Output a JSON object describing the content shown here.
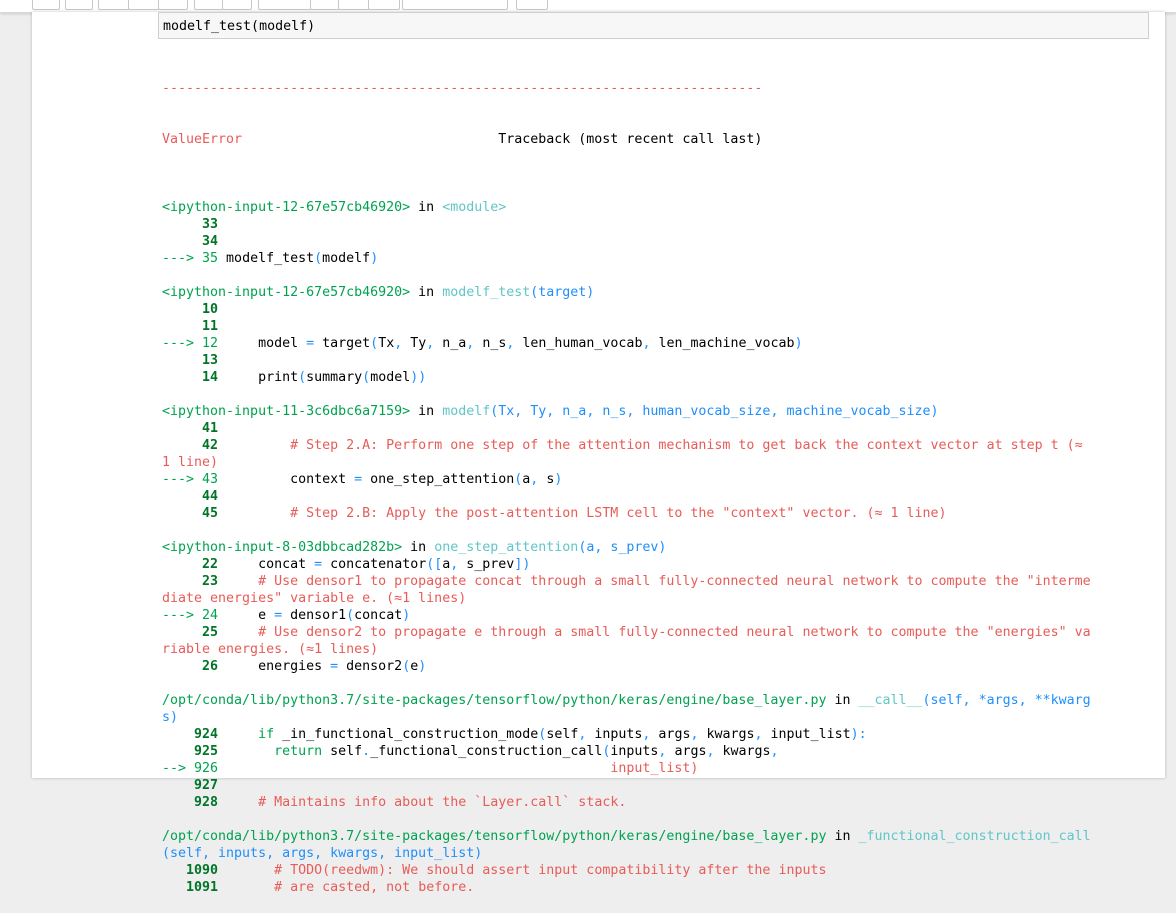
{
  "input": {
    "code": "modelf_test(modelf)"
  },
  "traceback": {
    "separator": "---------------------------------------------------------------------------",
    "error_name": "ValueError",
    "header": "                                Traceback (most recent call last)",
    "frames": [
      {
        "file": "<ipython-input-12-67e57cb46920>",
        "in": " in ",
        "func": "<module>",
        "func_args": "",
        "lines": [
          {
            "marker": "     ",
            "num": "33",
            "code": []
          },
          {
            "marker": "     ",
            "num": "34",
            "code": []
          },
          {
            "marker": "---> ",
            "num": "35",
            "code": [
              {
                "t": " modelf_test",
                "c": ""
              },
              {
                "t": "(",
                "c": "blue"
              },
              {
                "t": "modelf",
                "c": ""
              },
              {
                "t": ")",
                "c": "blue"
              }
            ]
          }
        ]
      },
      {
        "file": "<ipython-input-12-67e57cb46920>",
        "in": " in ",
        "func": "modelf_test",
        "func_args": "(target)",
        "lines": [
          {
            "marker": "     ",
            "num": "10",
            "code": []
          },
          {
            "marker": "     ",
            "num": "11",
            "code": []
          },
          {
            "marker": "---> ",
            "num": "12",
            "code": [
              {
                "t": "     model ",
                "c": ""
              },
              {
                "t": "=",
                "c": "blue"
              },
              {
                "t": " target",
                "c": ""
              },
              {
                "t": "(",
                "c": "blue"
              },
              {
                "t": "Tx",
                "c": ""
              },
              {
                "t": ",",
                "c": "blue"
              },
              {
                "t": " Ty",
                "c": ""
              },
              {
                "t": ",",
                "c": "blue"
              },
              {
                "t": " n_a",
                "c": ""
              },
              {
                "t": ",",
                "c": "blue"
              },
              {
                "t": " n_s",
                "c": ""
              },
              {
                "t": ",",
                "c": "blue"
              },
              {
                "t": " len_human_vocab",
                "c": ""
              },
              {
                "t": ",",
                "c": "blue"
              },
              {
                "t": " len_machine_vocab",
                "c": ""
              },
              {
                "t": ")",
                "c": "blue"
              }
            ]
          },
          {
            "marker": "     ",
            "num": "13",
            "code": []
          },
          {
            "marker": "     ",
            "num": "14",
            "code": [
              {
                "t": "     print",
                "c": ""
              },
              {
                "t": "(",
                "c": "blue"
              },
              {
                "t": "summary",
                "c": ""
              },
              {
                "t": "(",
                "c": "blue"
              },
              {
                "t": "model",
                "c": ""
              },
              {
                "t": "))",
                "c": "blue"
              }
            ]
          }
        ]
      },
      {
        "file": "<ipython-input-11-3c6dbc6a7159>",
        "in": " in ",
        "func": "modelf",
        "func_args": "(Tx, Ty, n_a, n_s, human_vocab_size, machine_vocab_size)",
        "lines": [
          {
            "marker": "     ",
            "num": "41",
            "code": []
          },
          {
            "marker": "     ",
            "num": "42",
            "code": [
              {
                "t": "         # Step 2.A: Perform one step of the attention mechanism to get back the context vector at step t (≈",
                "c": "red"
              }
            ]
          },
          {
            "marker": "",
            "num": "",
            "code": [
              {
                "t": "1 line)",
                "c": "red"
              }
            ]
          },
          {
            "marker": "---> ",
            "num": "43",
            "code": [
              {
                "t": "         context ",
                "c": ""
              },
              {
                "t": "=",
                "c": "blue"
              },
              {
                "t": " one_step_attention",
                "c": ""
              },
              {
                "t": "(",
                "c": "blue"
              },
              {
                "t": "a",
                "c": ""
              },
              {
                "t": ",",
                "c": "blue"
              },
              {
                "t": " s",
                "c": ""
              },
              {
                "t": ")",
                "c": "blue"
              }
            ]
          },
          {
            "marker": "     ",
            "num": "44",
            "code": []
          },
          {
            "marker": "     ",
            "num": "45",
            "code": [
              {
                "t": "         # Step 2.B: Apply the post-attention LSTM cell to the \"context\" vector. (≈ 1 line)",
                "c": "red"
              }
            ]
          }
        ]
      },
      {
        "file": "<ipython-input-8-03dbbcad282b>",
        "in": " in ",
        "func": "one_step_attention",
        "func_args": "(a, s_prev)",
        "lines": [
          {
            "marker": "     ",
            "num": "22",
            "code": [
              {
                "t": "     concat ",
                "c": ""
              },
              {
                "t": "=",
                "c": "blue"
              },
              {
                "t": " concatenator",
                "c": ""
              },
              {
                "t": "([",
                "c": "blue"
              },
              {
                "t": "a",
                "c": ""
              },
              {
                "t": ",",
                "c": "blue"
              },
              {
                "t": " s_prev",
                "c": ""
              },
              {
                "t": "])",
                "c": "blue"
              }
            ]
          },
          {
            "marker": "     ",
            "num": "23",
            "code": [
              {
                "t": "     # Use densor1 to propagate concat through a small fully-connected neural network to compute the \"interme",
                "c": "red"
              }
            ]
          },
          {
            "marker": "",
            "num": "",
            "code": [
              {
                "t": "diate energies\" variable e. (≈1 lines)",
                "c": "red"
              }
            ]
          },
          {
            "marker": "---> ",
            "num": "24",
            "code": [
              {
                "t": "     e ",
                "c": ""
              },
              {
                "t": "=",
                "c": "blue"
              },
              {
                "t": " densor1",
                "c": ""
              },
              {
                "t": "(",
                "c": "blue"
              },
              {
                "t": "concat",
                "c": ""
              },
              {
                "t": ")",
                "c": "blue"
              }
            ]
          },
          {
            "marker": "     ",
            "num": "25",
            "code": [
              {
                "t": "     # Use densor2 to propagate e through a small fully-connected neural network to compute the \"energies\" va",
                "c": "red"
              }
            ]
          },
          {
            "marker": "",
            "num": "",
            "code": [
              {
                "t": "riable energies. (≈1 lines)",
                "c": "red"
              }
            ]
          },
          {
            "marker": "     ",
            "num": "26",
            "code": [
              {
                "t": "     energies ",
                "c": ""
              },
              {
                "t": "=",
                "c": "blue"
              },
              {
                "t": " densor2",
                "c": ""
              },
              {
                "t": "(",
                "c": "blue"
              },
              {
                "t": "e",
                "c": ""
              },
              {
                "t": ")",
                "c": "blue"
              }
            ]
          }
        ]
      },
      {
        "file": "/opt/conda/lib/python3.7/site-packages/tensorflow/python/keras/engine/base_layer.py",
        "in": " in ",
        "func": "__call__",
        "func_args": "(self, *args, **kwarg",
        "func_args_wrap": "s)",
        "lines": [
          {
            "marker": "    ",
            "num": "924",
            "code": [
              {
                "t": "     if",
                "c": "green"
              },
              {
                "t": " _in_functional_construction_mode",
                "c": ""
              },
              {
                "t": "(",
                "c": "blue"
              },
              {
                "t": "self",
                "c": ""
              },
              {
                "t": ",",
                "c": "blue"
              },
              {
                "t": " inputs",
                "c": ""
              },
              {
                "t": ",",
                "c": "blue"
              },
              {
                "t": " args",
                "c": ""
              },
              {
                "t": ",",
                "c": "blue"
              },
              {
                "t": " kwargs",
                "c": ""
              },
              {
                "t": ",",
                "c": "blue"
              },
              {
                "t": " input_list",
                "c": ""
              },
              {
                "t": "):",
                "c": "blue"
              }
            ]
          },
          {
            "marker": "    ",
            "num": "925",
            "code": [
              {
                "t": "       return",
                "c": "green"
              },
              {
                "t": " self",
                "c": ""
              },
              {
                "t": ".",
                "c": "blue"
              },
              {
                "t": "_functional_construction_call",
                "c": ""
              },
              {
                "t": "(",
                "c": "blue"
              },
              {
                "t": "inputs",
                "c": ""
              },
              {
                "t": ",",
                "c": "blue"
              },
              {
                "t": " args",
                "c": ""
              },
              {
                "t": ",",
                "c": "blue"
              },
              {
                "t": " kwargs",
                "c": ""
              },
              {
                "t": ",",
                "c": "blue"
              }
            ]
          },
          {
            "marker": "--> ",
            "num": "926",
            "code": [
              {
                "t": "                                                 input_list)",
                "c": "red"
              }
            ]
          },
          {
            "marker": "    ",
            "num": "927",
            "code": []
          },
          {
            "marker": "    ",
            "num": "928",
            "code": [
              {
                "t": "     # Maintains info about the `Layer.call` stack.",
                "c": "red"
              }
            ]
          }
        ]
      },
      {
        "file": "/opt/conda/lib/python3.7/site-packages/tensorflow/python/keras/engine/base_layer.py",
        "in": " in ",
        "func": "_functional_construction_call",
        "func_args": "",
        "func_args_wrap": "(self, inputs, args, kwargs, input_list)",
        "lines": [
          {
            "marker": "   ",
            "num": "1090",
            "code": [
              {
                "t": "       # TODO(reedwm): We should assert input compatibility after the inputs",
                "c": "red"
              }
            ]
          },
          {
            "marker": "   ",
            "num": "1091",
            "code": [
              {
                "t": "       # are casted, not before.",
                "c": "red"
              }
            ]
          }
        ]
      }
    ]
  }
}
